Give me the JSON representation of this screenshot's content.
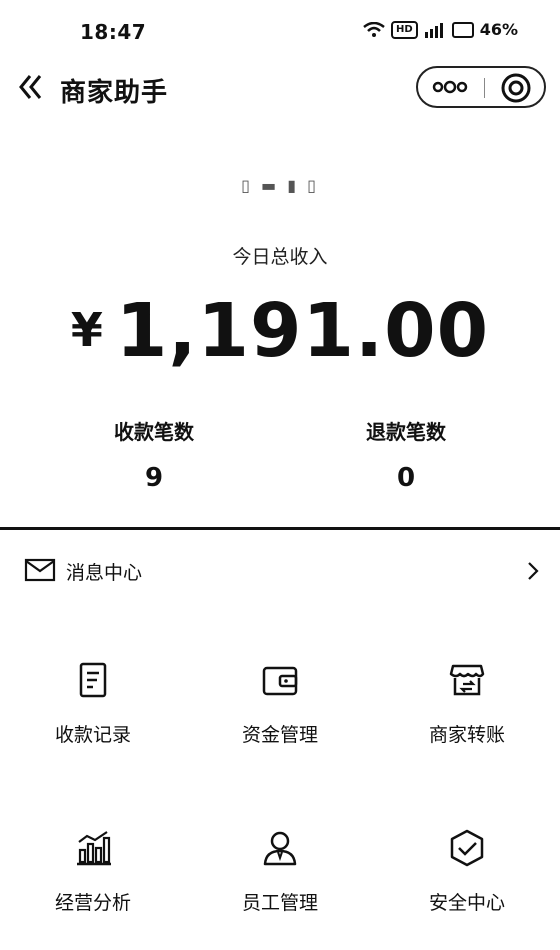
{
  "status_bar": {
    "time": "18:47",
    "battery": "46%",
    "hd_label": "HD"
  },
  "header": {
    "back_icon": "double-chevron-left-icon",
    "title": "商家助手",
    "more_icon": "more-dots-icon",
    "close_icon": "target-circle-icon"
  },
  "summary": {
    "shop_name": "▯ ▬ ▮ ▯",
    "income_label": "今日总收入",
    "currency": "¥",
    "income_amount": "1,191.00",
    "payments_label": "收款笔数",
    "payments_count": "9",
    "refunds_label": "退款笔数",
    "refunds_count": "0"
  },
  "message_center": {
    "icon": "envelope-icon",
    "label": "消息中心",
    "arrow_icon": "chevron-right-icon"
  },
  "menu": {
    "items": [
      {
        "label": "收款记录",
        "icon": "receipt-icon"
      },
      {
        "label": "资金管理",
        "icon": "wallet-icon"
      },
      {
        "label": "商家转账",
        "icon": "store-transfer-icon"
      },
      {
        "label": "经营分析",
        "icon": "bar-chart-icon"
      },
      {
        "label": "员工管理",
        "icon": "staff-icon"
      },
      {
        "label": "安全中心",
        "icon": "shield-check-icon"
      }
    ]
  }
}
